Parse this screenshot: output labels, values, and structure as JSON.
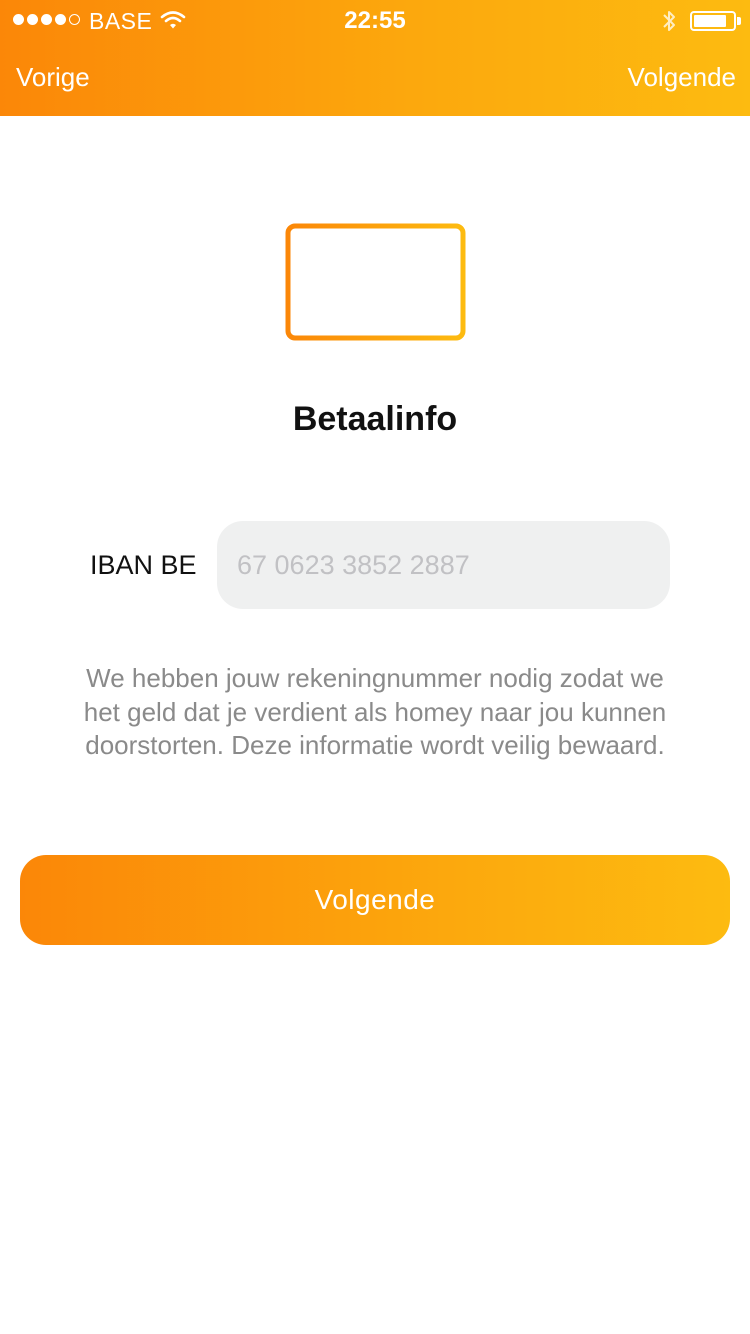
{
  "status_bar": {
    "carrier": "BASE",
    "time": "22:55",
    "signal_bars_filled": 4,
    "signal_bars_total": 5,
    "battery_level": 0.85
  },
  "nav": {
    "back_label": "Vorige",
    "next_label": "Volgende"
  },
  "main": {
    "icon": "credit-card-icon",
    "title": "Betaalinfo",
    "iban_label": "IBAN BE",
    "iban_value": "",
    "iban_placeholder": "67 0623 3852 2887",
    "description": "We hebben jouw rekeningnummer nodig zodat we het geld dat je verdient als homey naar jou kunnen doorstorten. Deze informatie wordt veilig bewaard.",
    "button_label": "Volgende"
  },
  "colors": {
    "gradient_start": "#fb8708",
    "gradient_end": "#fdbb10",
    "input_background": "#eff0f0",
    "description_text": "#8a8a8a"
  }
}
